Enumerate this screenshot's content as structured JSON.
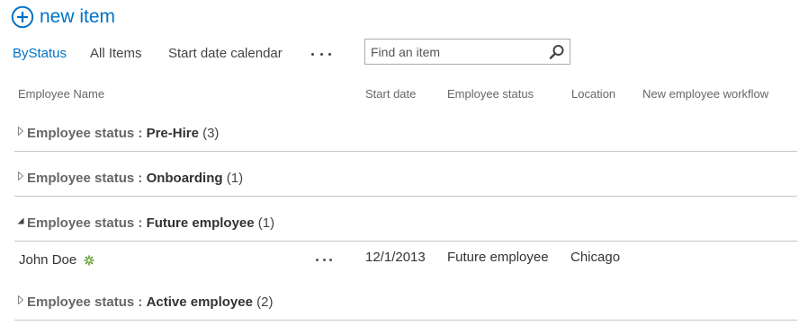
{
  "toolbar": {
    "new_item_label": "new item"
  },
  "views": {
    "tabs": [
      {
        "label": "ByStatus",
        "active": true
      },
      {
        "label": "All Items",
        "active": false
      },
      {
        "label": "Start date calendar",
        "active": false
      }
    ],
    "more_icon": "ellipsis-icon"
  },
  "search": {
    "placeholder": "Find an item",
    "value": "",
    "icon": "search-icon"
  },
  "columns": [
    "Employee Name",
    "Start date",
    "Employee status",
    "Location",
    "New employee workflow"
  ],
  "groups": [
    {
      "field": "Employee status",
      "separator": ":",
      "value": "Pre-Hire",
      "count": "(3)",
      "expanded": false
    },
    {
      "field": "Employee status",
      "separator": ":",
      "value": "Onboarding",
      "count": "(1)",
      "expanded": false
    },
    {
      "field": "Employee status",
      "separator": ":",
      "value": "Future employee",
      "count": "(1)",
      "expanded": true
    },
    {
      "field": "Employee status",
      "separator": ":",
      "value": "Active employee",
      "count": "(2)",
      "expanded": false
    }
  ],
  "items": [
    {
      "name": "John Doe",
      "new_icon": "new-item-badge-icon",
      "start_date": "12/1/2013",
      "employee_status": "Future employee",
      "location": "Chicago",
      "workflow": ""
    }
  ],
  "colors": {
    "accent": "#0072c6",
    "new_badge": "#5aa02c",
    "divider": "#c6c6c6"
  }
}
